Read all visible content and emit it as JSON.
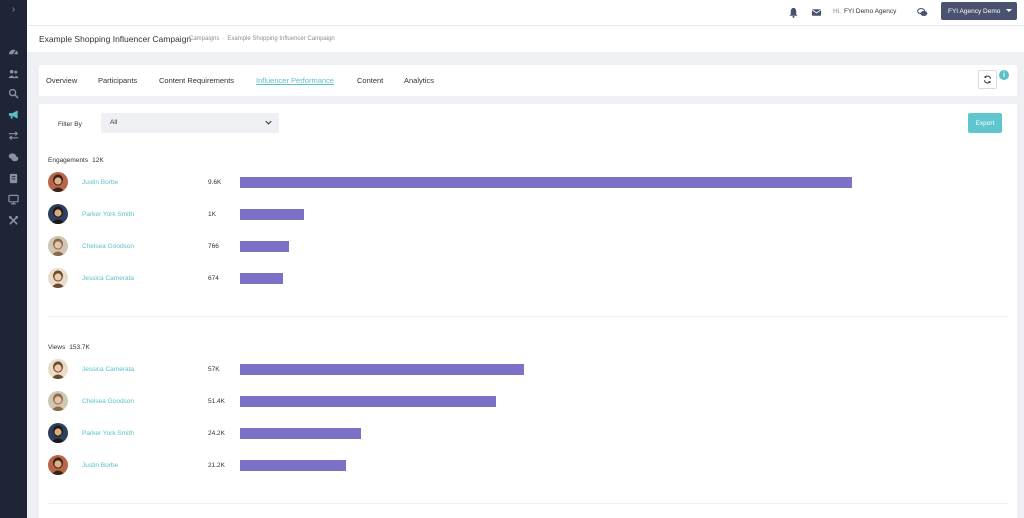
{
  "sidebar": {
    "toggle_glyph": "›",
    "items": [
      {
        "icon": "dashboard-icon"
      },
      {
        "icon": "users-icon"
      },
      {
        "icon": "search-icon"
      },
      {
        "icon": "megaphone-icon",
        "active": true
      },
      {
        "icon": "transfer-icon"
      },
      {
        "icon": "chat-icon"
      },
      {
        "icon": "document-icon"
      },
      {
        "icon": "monitor-icon"
      },
      {
        "icon": "tools-icon"
      }
    ]
  },
  "topbar": {
    "greeting_prefix": "Hi,",
    "user_name": "FYI Demo Agency",
    "agency_button": "FYI Agency Demo"
  },
  "page": {
    "title": "Example Shopping Influencer Campaign",
    "breadcrumb": [
      "Campaigns",
      "Example Shopping Influencer Campaign"
    ],
    "breadcrumb_separator": "·"
  },
  "tabs": [
    {
      "label": "Overview",
      "active": false
    },
    {
      "label": "Participants",
      "active": false
    },
    {
      "label": "Content Requirements",
      "active": false
    },
    {
      "label": "Influencer Performance",
      "active": true
    },
    {
      "label": "Content",
      "active": false
    },
    {
      "label": "Analytics",
      "active": false
    }
  ],
  "info_glyph": "i",
  "filter": {
    "label": "Filter By",
    "value": "All"
  },
  "export_label": "Export",
  "colors": {
    "accent": "#5bc0c9",
    "bar": "#7b72c8",
    "sidebar_bg": "#1f2436",
    "agency_button_bg": "#4a5270"
  },
  "sections": [
    {
      "title": "Engagements",
      "total": "12K",
      "rows": [
        {
          "name": "Justin Borbe",
          "display": "9.6K",
          "value": 9600,
          "avatar": "avatar-justin"
        },
        {
          "name": "Parker York Smith",
          "display": "1K",
          "value": 1000,
          "avatar": "avatar-parker"
        },
        {
          "name": "Chelsea Goodson",
          "display": "766",
          "value": 766,
          "avatar": "avatar-chelsea"
        },
        {
          "name": "Jessica Camerata",
          "display": "674",
          "value": 674,
          "avatar": "avatar-jessica"
        }
      ]
    },
    {
      "title": "Views",
      "total": "153.7K",
      "rows": [
        {
          "name": "Jessica Camerata",
          "display": "57K",
          "value": 57000,
          "avatar": "avatar-jessica"
        },
        {
          "name": "Chelsea Goodson",
          "display": "51.4K",
          "value": 51400,
          "avatar": "avatar-chelsea"
        },
        {
          "name": "Parker York Smith",
          "display": "24.2K",
          "value": 24200,
          "avatar": "avatar-parker"
        },
        {
          "name": "Justin Borbe",
          "display": "21.2K",
          "value": 21200,
          "avatar": "avatar-justin"
        }
      ]
    }
  ]
}
